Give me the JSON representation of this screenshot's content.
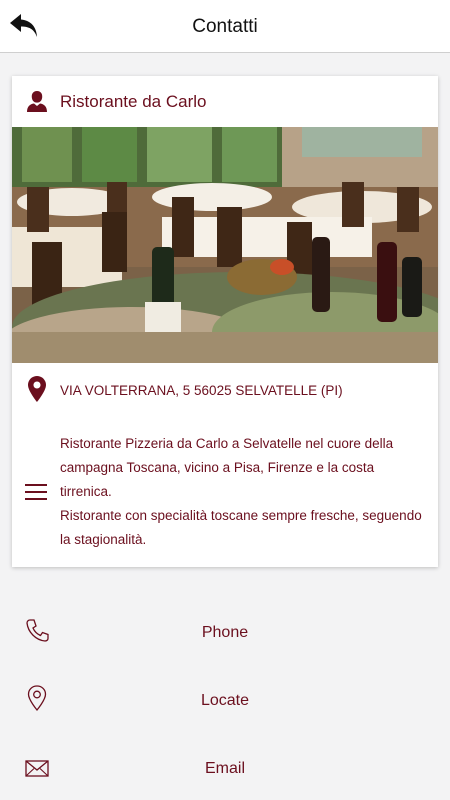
{
  "header": {
    "title": "Contatti",
    "back_icon": "back-arrow-icon"
  },
  "card": {
    "title": "Ristorante da Carlo",
    "title_icon": "user-silhouette-icon",
    "photo": "restaurant-dining-room-photo",
    "address": "VIA VOLTERRANA, 5 56025 SELVATELLE (PI)",
    "address_icon": "map-pin-icon",
    "description_icon": "menu-lines-icon",
    "description": [
      "Ristorante Pizzeria da Carlo a Selvatelle nel cuore della campagna Toscana, vicino a Pisa, Firenze e la costa tirrenica.",
      "Ristorante con specialità toscane sempre fresche, seguendo la stagionalità."
    ]
  },
  "actions": [
    {
      "label": "Phone",
      "icon": "phone-icon"
    },
    {
      "label": "Locate",
      "icon": "location-pin-icon"
    },
    {
      "label": "Email",
      "icon": "envelope-icon"
    }
  ],
  "colors": {
    "accent": "#6b0f1e",
    "background": "#f3f3f4",
    "card": "#ffffff"
  }
}
